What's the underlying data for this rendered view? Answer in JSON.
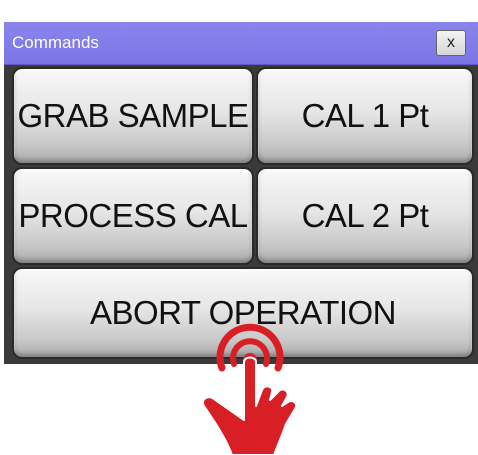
{
  "window": {
    "title": "Commands",
    "close_label": "x"
  },
  "buttons": {
    "grab_sample": "GRAB SAMPLE",
    "cal_1pt": "CAL 1 Pt",
    "process_cal": "PROCESS CAL",
    "cal_2pt": "CAL 2 Pt",
    "abort_operation": "ABORT OPERATION"
  },
  "colors": {
    "titlebar": "#7a74e6",
    "button_face": "#e6e6e6",
    "hand": "#d81f26"
  },
  "icons": {
    "pointer": "tap-hand-icon"
  }
}
